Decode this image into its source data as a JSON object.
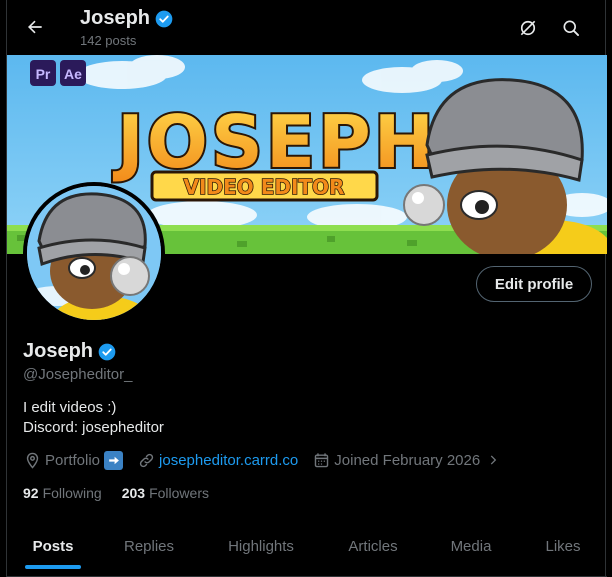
{
  "header": {
    "title": "Joseph",
    "posts_count": "142 posts"
  },
  "banner": {
    "text_main": "JOSEPH",
    "text_sub": "VIDEO EDITOR",
    "badge_pr": "Pr",
    "badge_ae": "Ae"
  },
  "profile": {
    "name": "Joseph",
    "handle": "@Josepheditor_",
    "bio_line1": "I edit videos :)",
    "bio_line2": "Discord: josepheditor",
    "edit_button": "Edit profile",
    "location": "Portfolio",
    "website": "josepheditor.carrd.co",
    "joined": "Joined February 2026"
  },
  "stats": {
    "following_count": "92",
    "following_label": "Following",
    "followers_count": "203",
    "followers_label": "Followers"
  },
  "tabs": [
    {
      "label": "Posts"
    },
    {
      "label": "Replies"
    },
    {
      "label": "Highlights"
    },
    {
      "label": "Articles"
    },
    {
      "label": "Media"
    },
    {
      "label": "Likes"
    }
  ],
  "colors": {
    "accent": "#1d9bf0",
    "background": "#000000",
    "muted": "#71767b"
  },
  "active_tab_index": 0
}
